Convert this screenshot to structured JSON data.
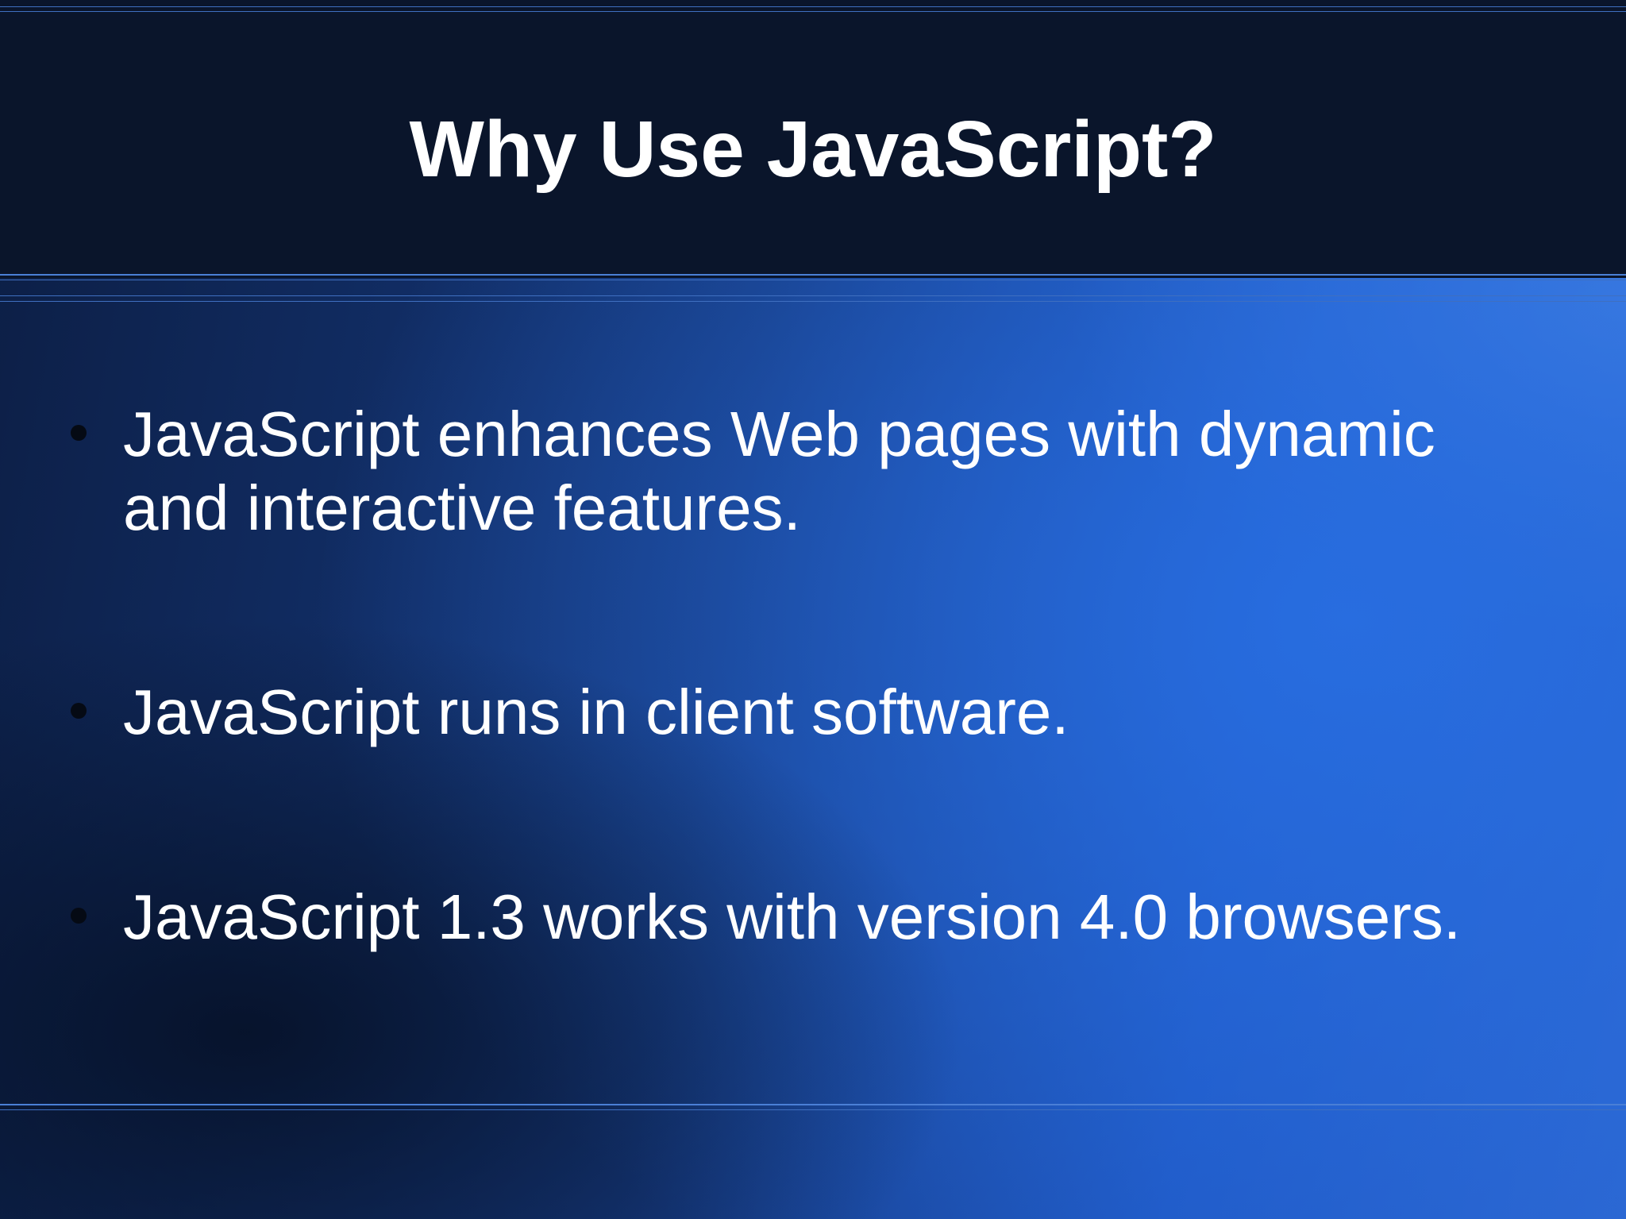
{
  "slide": {
    "title": "Why Use JavaScript?",
    "bullets": [
      {
        "line1": "JavaScript enhances Web pages with dynamic",
        "line2": "and interactive features."
      },
      {
        "line1": "JavaScript runs in client software."
      },
      {
        "line1": "JavaScript 1.3 works with version 4.0 browsers."
      }
    ]
  },
  "colors": {
    "header_background": "#0a152b",
    "text": "#ffffff",
    "accent_line": "#4a7fd6"
  }
}
